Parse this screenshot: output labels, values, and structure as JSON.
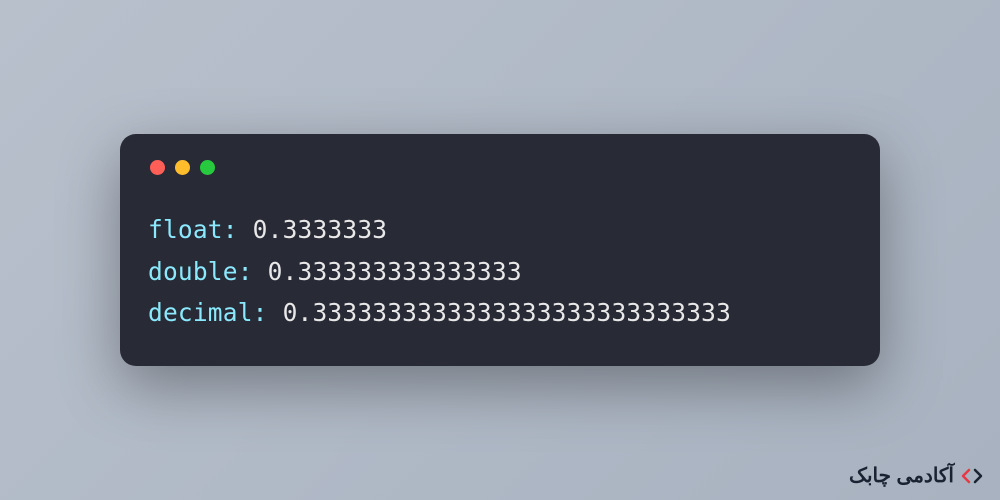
{
  "terminal": {
    "window_controls": {
      "close_color": "#ff5f56",
      "minimize_color": "#ffbd2e",
      "maximize_color": "#27c93f"
    },
    "lines": [
      {
        "label": "float",
        "value": "0.3333333"
      },
      {
        "label": "double",
        "value": "0.333333333333333"
      },
      {
        "label": "decimal",
        "value": "0.3333333333333333333333333333"
      }
    ]
  },
  "watermark": {
    "text": "آکادمی چابک"
  }
}
